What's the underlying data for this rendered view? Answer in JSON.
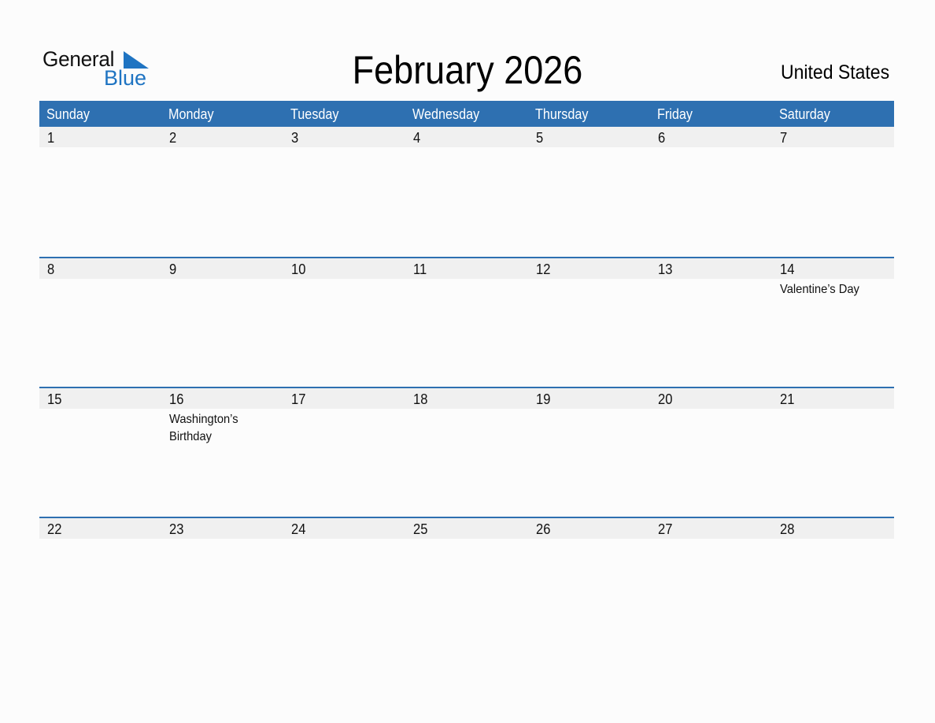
{
  "logo": {
    "word1": "General",
    "word2": "Blue"
  },
  "title": "February 2026",
  "country": "United States",
  "colors": {
    "accent": "#2e70b1",
    "logo_blue": "#1f74c2",
    "date_strip": "#f0f0f0"
  },
  "weekdays": [
    "Sunday",
    "Monday",
    "Tuesday",
    "Wednesday",
    "Thursday",
    "Friday",
    "Saturday"
  ],
  "weeks": [
    {
      "days": [
        {
          "date": "1",
          "event": ""
        },
        {
          "date": "2",
          "event": ""
        },
        {
          "date": "3",
          "event": ""
        },
        {
          "date": "4",
          "event": ""
        },
        {
          "date": "5",
          "event": ""
        },
        {
          "date": "6",
          "event": ""
        },
        {
          "date": "7",
          "event": ""
        }
      ]
    },
    {
      "days": [
        {
          "date": "8",
          "event": ""
        },
        {
          "date": "9",
          "event": ""
        },
        {
          "date": "10",
          "event": ""
        },
        {
          "date": "11",
          "event": ""
        },
        {
          "date": "12",
          "event": ""
        },
        {
          "date": "13",
          "event": ""
        },
        {
          "date": "14",
          "event": "Valentine’s Day"
        }
      ]
    },
    {
      "days": [
        {
          "date": "15",
          "event": ""
        },
        {
          "date": "16",
          "event": "Washington’s Birthday"
        },
        {
          "date": "17",
          "event": ""
        },
        {
          "date": "18",
          "event": ""
        },
        {
          "date": "19",
          "event": ""
        },
        {
          "date": "20",
          "event": ""
        },
        {
          "date": "21",
          "event": ""
        }
      ]
    },
    {
      "days": [
        {
          "date": "22",
          "event": ""
        },
        {
          "date": "23",
          "event": ""
        },
        {
          "date": "24",
          "event": ""
        },
        {
          "date": "25",
          "event": ""
        },
        {
          "date": "26",
          "event": ""
        },
        {
          "date": "27",
          "event": ""
        },
        {
          "date": "28",
          "event": ""
        }
      ]
    }
  ]
}
